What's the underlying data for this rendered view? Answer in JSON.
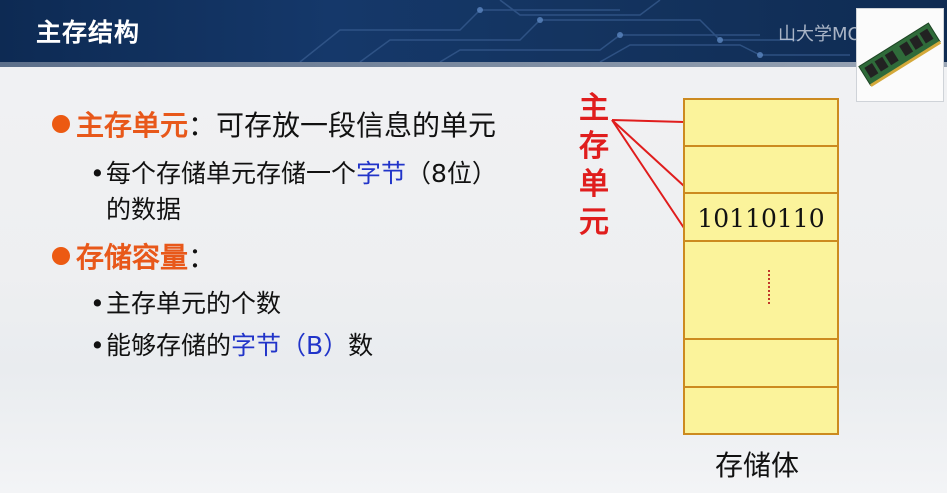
{
  "header": {
    "title": "主存结构",
    "watermark": "山大学MOOC"
  },
  "bullets": [
    {
      "keyword": "主存单元",
      "text": "：可存放一段信息的单元"
    },
    {
      "keyword": "存储容量",
      "text": "："
    }
  ],
  "subitems": {
    "unit_line1_a": "每个存储单元存储一个",
    "unit_line1_b": "字节",
    "unit_line1_c": "（8位）",
    "unit_line2": "的数据",
    "capacity_1": "主存单元的个数",
    "capacity_2a": "能够存储的",
    "capacity_2b": "字节（B）",
    "capacity_2c": "数"
  },
  "diagram": {
    "unit_label_chars": [
      "主",
      "存",
      "单",
      "元"
    ],
    "cell_value": "10110110",
    "storage_label": "存储体",
    "colors": {
      "cell_fill": "#fbf39b",
      "cell_border": "#cc8a1f",
      "arrow": "#e01d1d"
    }
  },
  "icons": {
    "bullet": "orange-dot-icon",
    "photo": "ram-module-icon"
  }
}
